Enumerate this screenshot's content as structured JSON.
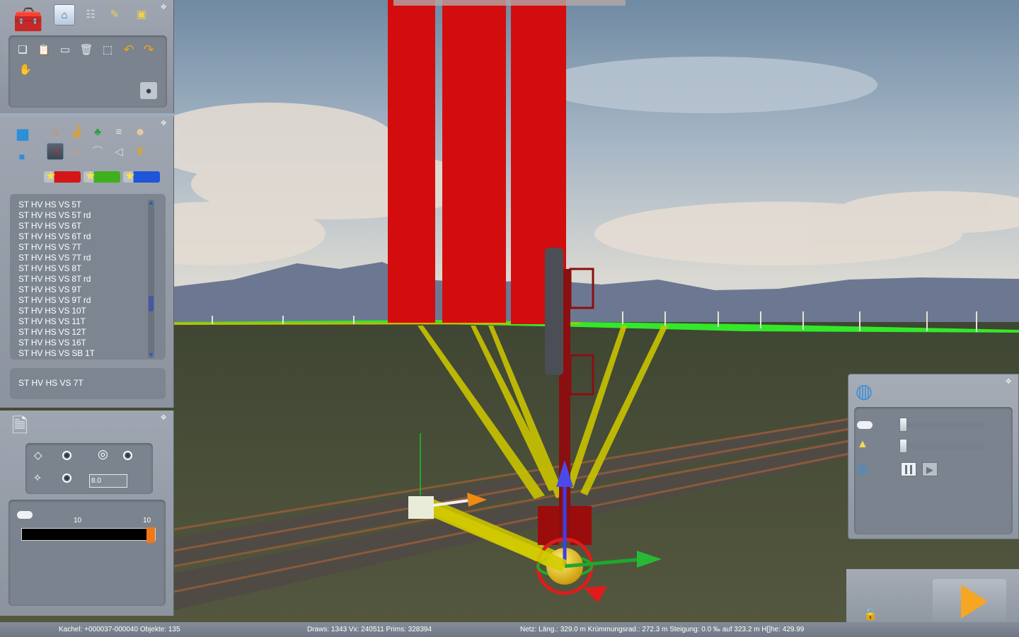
{
  "objects_panel": {
    "list_items": [
      "ST HV HS VS  5T",
      "ST HV HS VS  5T rd",
      "ST HV HS VS  6T",
      "ST HV HS VS  6T rd",
      "ST HV HS VS  7T",
      "ST HV HS VS  7T rd",
      "ST HV HS VS  8T",
      "ST HV HS VS  8T rd",
      "ST HV HS VS  9T",
      "ST HV HS VS  9T rd",
      "ST HV HS VS 10T",
      "ST HV HS VS 11T",
      "ST HV HS VS 12T",
      "ST HV HS VS 16T",
      "ST HV HS VS SB  1T"
    ],
    "selected_object": "ST HV HS VS  7T",
    "filter_colors": [
      "#d31616",
      "#3fb01c",
      "#1f55d8"
    ]
  },
  "props_panel": {
    "height_value": "8.0",
    "slider_label_left": "10",
    "slider_label_right": "10",
    "slider_fraction": 1.0
  },
  "right_panel": {
    "slider1_fraction": 0.0,
    "slider2_fraction": 0.0
  },
  "icons": {
    "tools": [
      "toolbox-icon",
      "home-icon",
      "track-icon",
      "brush-icon",
      "train-icon"
    ],
    "edit": [
      "copy-icon",
      "paste-icon",
      "screen-icon",
      "delete-icon",
      "measure-icon",
      "undo-icon",
      "redo-icon",
      "pan-icon",
      "bomb-icon"
    ],
    "categories": [
      "house-icon",
      "factory-icon",
      "tree-icon",
      "rail-piece-icon",
      "person-icon",
      "signal-icon",
      "platform-icon",
      "bridge-icon",
      "sound-icon",
      "bag-icon"
    ]
  },
  "status": {
    "tile": "Kachel: +000037-000040  Objekte: 135",
    "draws": "Draws: 1343 Vx: 240511 Prims: 328394",
    "net": "Netz:  Läng.:  329.0 m Krümmungsrad.: 272.3 m Steigung:  0.0 ‰ auf 323.2 m H[]he: 429.99"
  },
  "colors": {
    "sky": "#8da3ba",
    "ground": "#51553f",
    "signal_red": "#d30d0d",
    "highlight_green": "#33e82a",
    "beam_yellow": "#c9c300",
    "panel": "#939aa5"
  }
}
